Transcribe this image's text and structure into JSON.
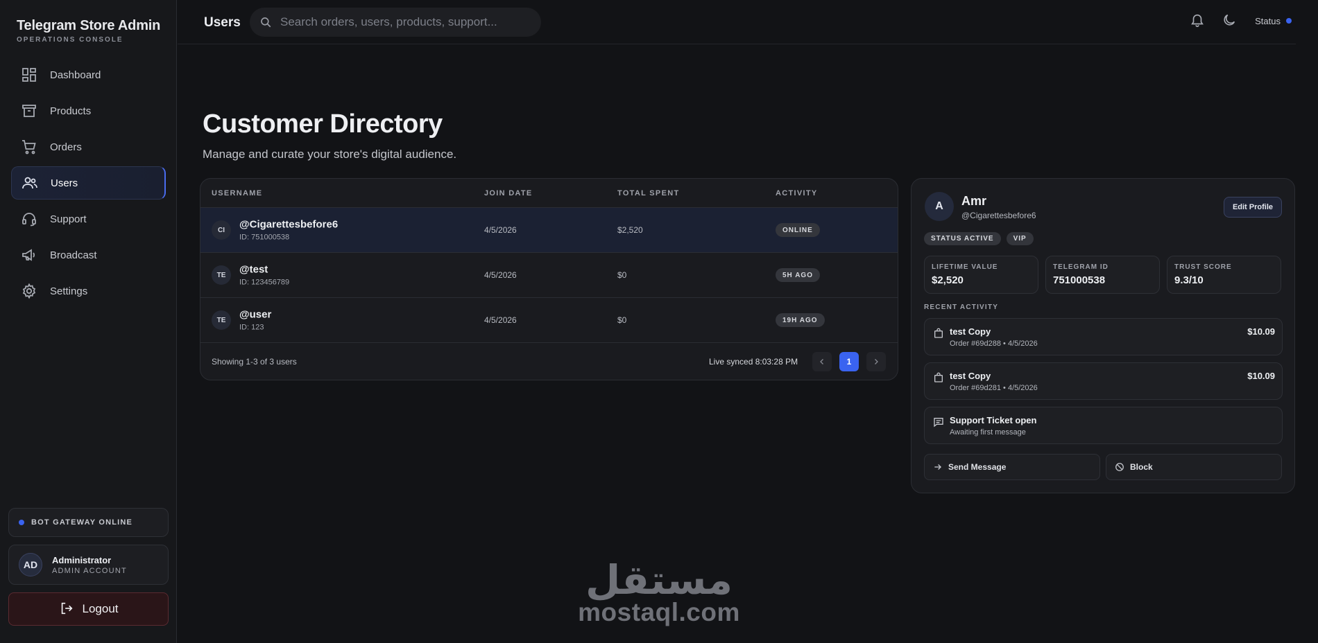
{
  "sidebar": {
    "brand_title": "Telegram Store Admin",
    "brand_subtitle": "OPERATIONS CONSOLE",
    "items": [
      {
        "label": "Dashboard",
        "icon": "dashboard-icon"
      },
      {
        "label": "Products",
        "icon": "box-icon"
      },
      {
        "label": "Orders",
        "icon": "cart-icon"
      },
      {
        "label": "Users",
        "icon": "users-icon",
        "active": true
      },
      {
        "label": "Support",
        "icon": "headset-icon"
      },
      {
        "label": "Broadcast",
        "icon": "megaphone-icon"
      },
      {
        "label": "Settings",
        "icon": "gear-icon"
      }
    ],
    "gateway_status": "BOT GATEWAY ONLINE",
    "admin_initials": "AD",
    "admin_name": "Administrator",
    "admin_role": "ADMIN ACCOUNT",
    "logout_label": "Logout"
  },
  "topbar": {
    "page_heading": "Users",
    "search_placeholder": "Search orders, users, products, support...",
    "status_label": "Status"
  },
  "main": {
    "title": "Customer Directory",
    "subtitle": "Manage and curate your store's digital audience."
  },
  "table": {
    "headers": {
      "username": "USERNAME",
      "join_date": "JOIN DATE",
      "total_spent": "TOTAL SPENT",
      "activity": "ACTIVITY"
    },
    "rows": [
      {
        "initials": "CI",
        "username": "@Cigarettesbefore6",
        "id": "ID: 751000538",
        "join_date": "4/5/2026",
        "total_spent": "$2,520",
        "activity": "ONLINE"
      },
      {
        "initials": "TE",
        "username": "@test",
        "id": "ID: 123456789",
        "join_date": "4/5/2026",
        "total_spent": "$0",
        "activity": "5H AGO"
      },
      {
        "initials": "TE",
        "username": "@user",
        "id": "ID: 123",
        "join_date": "4/5/2026",
        "total_spent": "$0",
        "activity": "19H AGO"
      }
    ],
    "showing": "Showing 1-3 of 3 users",
    "synced": "Live synced 8:03:28 PM",
    "current_page": "1"
  },
  "profile": {
    "initial": "A",
    "name": "Amr",
    "handle": "@Cigarettesbefore6",
    "edit_label": "Edit Profile",
    "tags": [
      "STATUS ACTIVE",
      "VIP"
    ],
    "stats": [
      {
        "label": "LIFETIME VALUE",
        "value": "$2,520"
      },
      {
        "label": "TELEGRAM ID",
        "value": "751000538"
      },
      {
        "label": "TRUST SCORE",
        "value": "9.3/10"
      }
    ],
    "recent_activity_title": "RECENT ACTIVITY",
    "activity": [
      {
        "icon": "bag-icon",
        "title": "test Copy",
        "subtitle": "Order #69d288 • 4/5/2026",
        "amount": "$10.09"
      },
      {
        "icon": "bag-icon",
        "title": "test Copy",
        "subtitle": "Order #69d281 • 4/5/2026",
        "amount": "$10.09"
      },
      {
        "icon": "chat-icon",
        "title": "Support Ticket open",
        "subtitle": "Awaiting first message",
        "amount": ""
      }
    ],
    "send_message_label": "Send Message",
    "block_label": "Block"
  },
  "watermark": {
    "arabic": "مستقل",
    "latin": "mostaql.com"
  },
  "colors": {
    "accent": "#3a63f0",
    "background": "#121316",
    "card": "#1a1b1f",
    "logout_bg": "#2a1518"
  }
}
